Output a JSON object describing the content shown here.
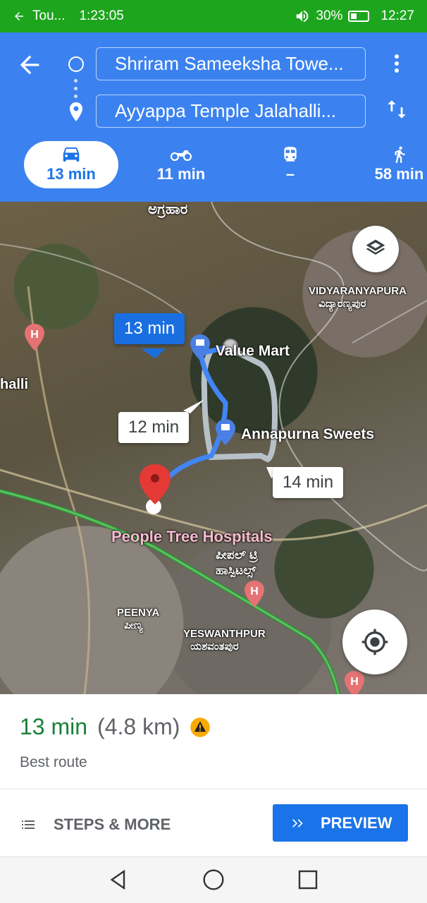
{
  "status_bar": {
    "app": "Tou...",
    "elapsed": "1:23:05",
    "battery": "30%",
    "clock": "12:27"
  },
  "directions": {
    "origin": "Shriram Sameeksha Towe...",
    "destination": "Ayyappa Temple Jalahalli...",
    "modes": [
      {
        "name": "drive",
        "label": "13 min",
        "selected": true
      },
      {
        "name": "two-wheeler",
        "label": "11 min",
        "selected": false
      },
      {
        "name": "transit",
        "label": "–",
        "selected": false
      },
      {
        "name": "walk",
        "label": "58 min",
        "selected": false
      }
    ]
  },
  "map": {
    "route_labels": {
      "primary": "13 min",
      "alt1": "12 min",
      "alt2": "14 min"
    },
    "places": {
      "value_mart": "Value Mart",
      "annapurna": "Annapurna Sweets",
      "people_tree": "People Tree Hospitals",
      "people_tree_kn": "ಪೀಪಲ್ ಟ್ರಿ ಹಾಸ್ಪಿಟಲ್ಸ್",
      "vidyaranyapura": "VIDYARANYAPURA",
      "vidyaranyapura_kn": "ವಿದ್ಯಾರಣ್ಯಪುರ",
      "agrahara_kn": "ಅಗ್ರಹಾರ",
      "jalahalli": "halli",
      "peenya": "PEENYA",
      "peenya_kn": "ಪೀಣ್ಯ",
      "yeswanthpur": "YESWANTHPUR",
      "yeswanthpur_kn": "ಯಶವಂತಪುರ"
    }
  },
  "summary": {
    "duration": "13 min",
    "distance": "(4.8 km)",
    "note": "Best route"
  },
  "actions": {
    "steps": "STEPS & MORE",
    "preview": "PREVIEW"
  },
  "colors": {
    "header": "#3b82f0",
    "status": "#1ea51e",
    "route_primary": "#4285f4",
    "route_alt": "#b9c3cc",
    "duration_green": "#188038",
    "accent": "#1a73e8"
  }
}
